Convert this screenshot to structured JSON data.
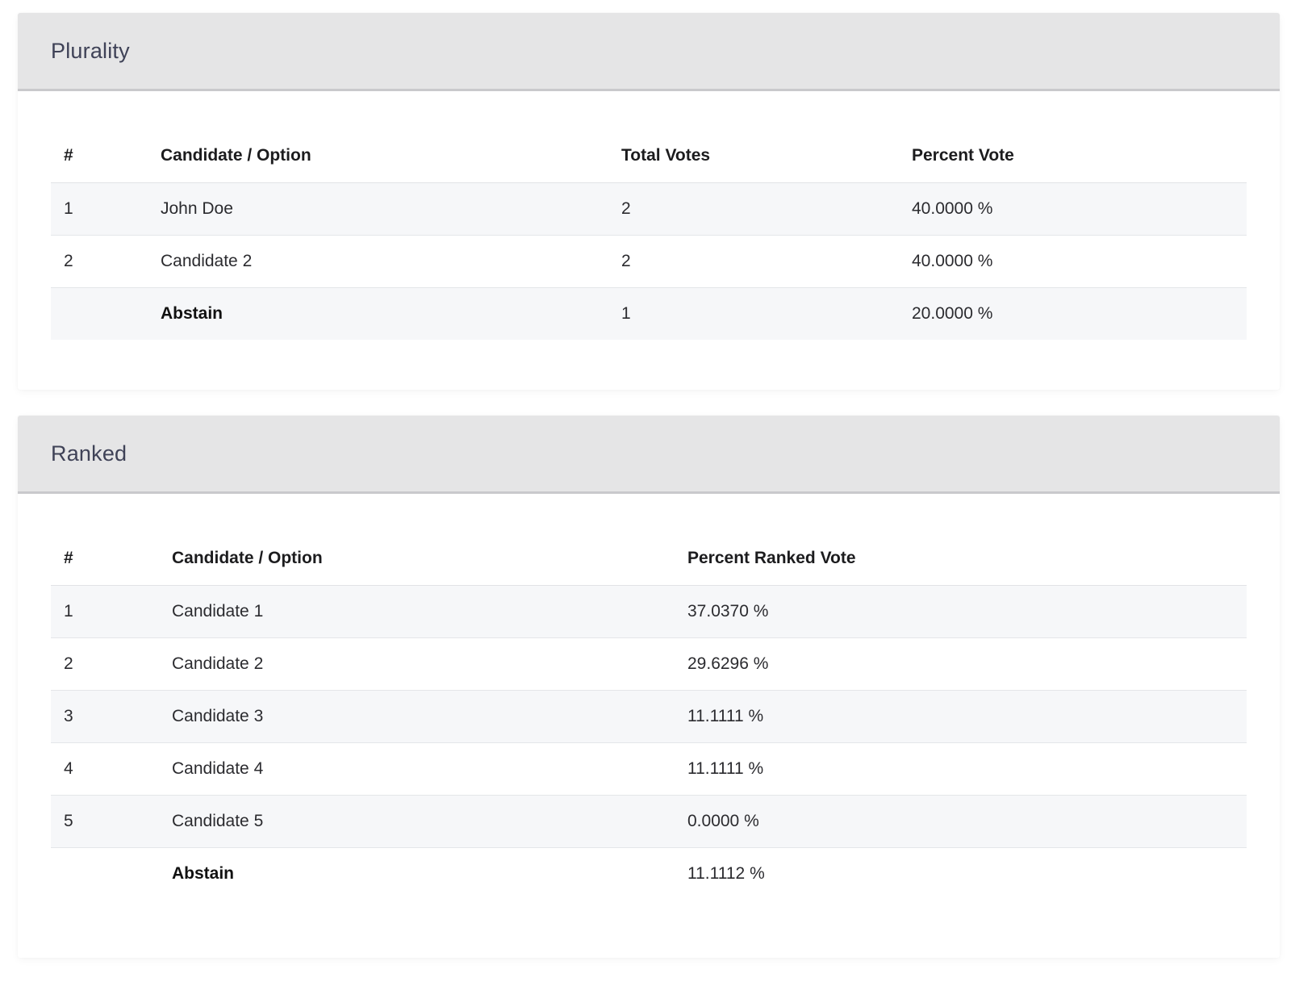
{
  "plurality": {
    "title": "Plurality",
    "headers": [
      "#",
      "Candidate / Option",
      "Total Votes",
      "Percent Vote"
    ],
    "rows": [
      {
        "rank": "1",
        "name": "John Doe",
        "votes": "2",
        "percent": "40.0000 %"
      },
      {
        "rank": "2",
        "name": "Candidate 2",
        "votes": "2",
        "percent": "40.0000 %"
      },
      {
        "rank": "",
        "name": "Abstain",
        "votes": "1",
        "percent": "20.0000 %"
      }
    ]
  },
  "ranked": {
    "title": "Ranked",
    "headers": [
      "#",
      "Candidate / Option",
      "Percent Ranked Vote"
    ],
    "rows": [
      {
        "rank": "1",
        "name": "Candidate 1",
        "percent": "37.0370 %"
      },
      {
        "rank": "2",
        "name": "Candidate 2",
        "percent": "29.6296 %"
      },
      {
        "rank": "3",
        "name": "Candidate 3",
        "percent": "11.1111 %"
      },
      {
        "rank": "4",
        "name": "Candidate 4",
        "percent": "11.1111 %"
      },
      {
        "rank": "5",
        "name": "Candidate 5",
        "percent": "0.0000 %"
      },
      {
        "rank": "",
        "name": "Abstain",
        "percent": "11.1112 %"
      }
    ]
  }
}
